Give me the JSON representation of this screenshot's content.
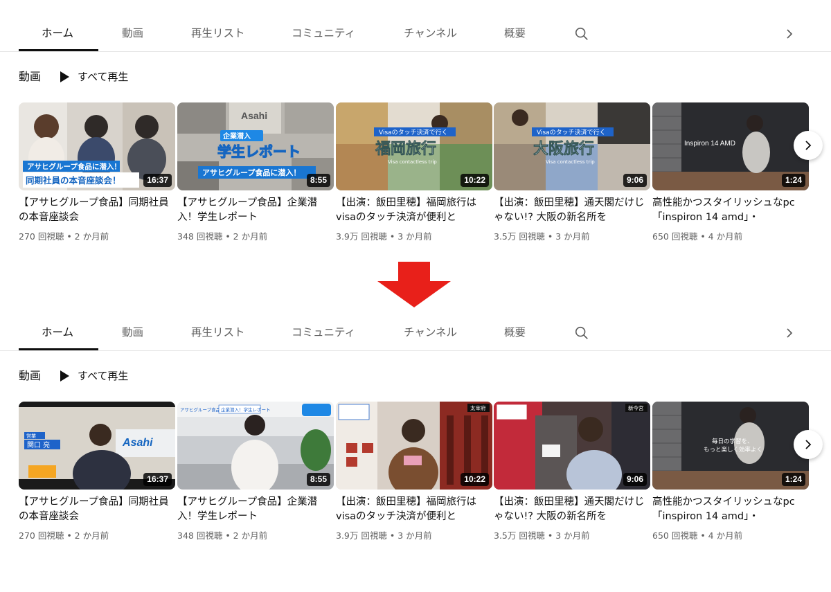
{
  "colors": {
    "arrow": "#e8201a",
    "active_tab": "#0f0f0f",
    "inactive_tab": "#606060"
  },
  "tabs": [
    {
      "label": "ホーム"
    },
    {
      "label": "動画"
    },
    {
      "label": "再生リスト"
    },
    {
      "label": "コミュニティ"
    },
    {
      "label": "チャンネル"
    },
    {
      "label": "概要"
    }
  ],
  "icons": {
    "search": "search-icon",
    "tabs_next": "chevron-right-icon",
    "play": "play-icon",
    "carousel_next": "chevron-right-icon"
  },
  "section": {
    "title": "動画",
    "play_all": "すべて再生"
  },
  "videos": [
    {
      "title": "【アサヒグループ食品】同期社員の本音座談会",
      "duration": "16:37",
      "views": "270 回視聴",
      "age": "2 か月前"
    },
    {
      "title": "【アサヒグループ食品】企業潜入！学生レポート",
      "duration": "8:55",
      "views": "348 回視聴",
      "age": "2 か月前"
    },
    {
      "title": "【出演：飯田里穂】福岡旅行はvisaのタッチ決済が便利と",
      "duration": "10:22",
      "views": "3.9万 回視聴",
      "age": "3 か月前"
    },
    {
      "title": "【出演：飯田里穂】通天閣だけじゃない!? 大阪の新名所を",
      "duration": "9:06",
      "views": "3.5万 回視聴",
      "age": "3 か月前"
    },
    {
      "title": "高性能かつスタイリッシュなpc「inspiron 14 amd」・",
      "duration": "1:24",
      "views": "650 回視聴",
      "age": "4 か月前"
    }
  ],
  "before_thumb_text": [
    {
      "banner": "アサヒグループ食品に潜入！",
      "caption": "同期社員の本音座談会！"
    },
    {
      "banner": "企業潜入",
      "big": "学生レポート",
      "caption": "アサヒグループ食品に潜入！",
      "brand": "Asahi"
    },
    {
      "badge": "Visaのタッチ決済で行く",
      "big": "福岡旅行",
      "small": "Visa contactless trip"
    },
    {
      "badge": "Visaのタッチ決済で行く",
      "big": "大阪旅行",
      "small": "Visa contactless trip"
    },
    {
      "label": "Inspiron 14 AMD"
    }
  ],
  "after_thumb_text": [
    {
      "caption1": "営業",
      "caption2": "関口 亮",
      "brand": "Asahi"
    },
    {
      "tag1": "アサヒグループ食品",
      "tag2": "企業潜入！学生レポート"
    },
    {
      "corner": "太宰府"
    },
    {
      "corner": "新今宮"
    },
    {
      "line1": "毎日の学習を、",
      "line2": "もっと楽しく効率よく"
    }
  ]
}
